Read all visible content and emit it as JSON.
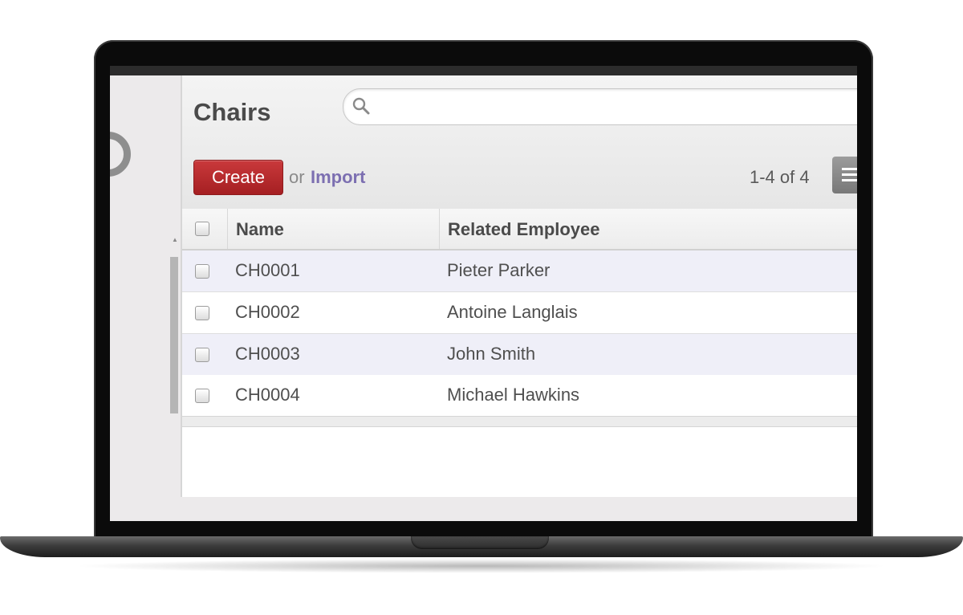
{
  "app": {
    "title": "Chairs",
    "actions": {
      "create_label": "Create",
      "or_label": "or",
      "import_label": "Import"
    },
    "search": {
      "value": "",
      "placeholder": ""
    },
    "pager": {
      "text": "1-4 of 4"
    },
    "list": {
      "columns": [
        "Name",
        "Related Employee"
      ],
      "rows": [
        {
          "name": "CH0001",
          "employee": "Pieter Parker"
        },
        {
          "name": "CH0002",
          "employee": "Antoine Langlais"
        },
        {
          "name": "CH0003",
          "employee": "John Smith"
        },
        {
          "name": "CH0004",
          "employee": "Michael Hawkins"
        }
      ]
    }
  },
  "icons": [
    "search-icon",
    "list-view-icon",
    "logo-ring-icon"
  ],
  "colors": {
    "create_button": "#b8292c",
    "import_link": "#7c6fb1",
    "odd_row": "#efeff8"
  }
}
